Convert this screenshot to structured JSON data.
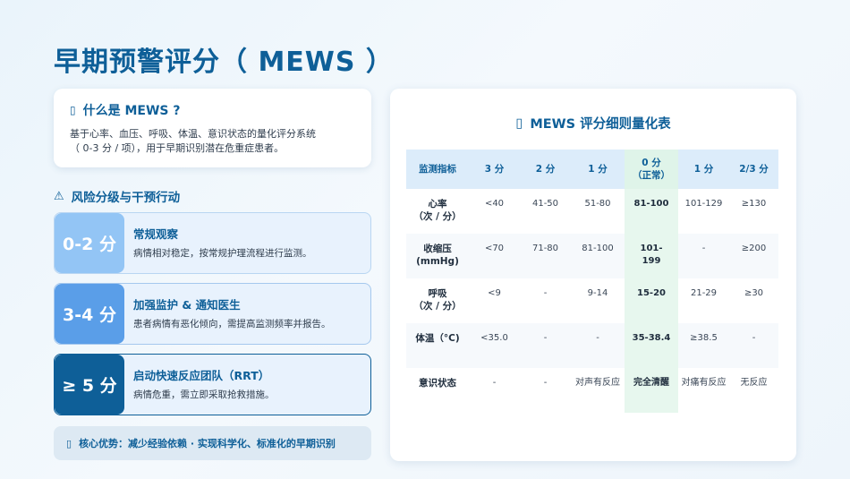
{
  "page": {
    "title": "早期预警评分（ MEWS ）"
  },
  "what": {
    "icon": "info-icon",
    "title": "什么是  MEWS ?",
    "desc_line1": "基于心率、血压、呼吸、体温、意识状态的量化评分系统",
    "desc_line2": "（  0-3 分 / 项），用于早期识别潜在危重症患者。"
  },
  "risk": {
    "icon": "warning-icon",
    "heading": "风险分级与干预行动",
    "levels": [
      {
        "score": "0-2 分",
        "title": "常规观察",
        "desc": "病情相对稳定，按常规护理流程进行监测。"
      },
      {
        "score": "3-4 分",
        "title": "加强监护  &  通知医生",
        "desc": "患者病情有恶化倾向，需提高监测频率并报告。"
      },
      {
        "score": "≥ 5 分",
        "title": "启动快速反应团队（RRT）",
        "desc": "病情危重，需立即采取抢救措施。"
      }
    ]
  },
  "advantage": {
    "icon": "star-icon",
    "text": "核心优势：减少经验依赖 · 实现科学化、标准化的早期识别"
  },
  "table": {
    "icon": "table-icon",
    "title": "MEWS  评分细则量化表",
    "headers": [
      "监测指标",
      "3 分",
      "2 分",
      "1 分",
      "0 分\n（正常）",
      "1 分",
      "2/3 分"
    ],
    "rows": [
      {
        "name": "心率\n（次 / 分）",
        "cells": [
          "<40",
          "41-50",
          "51-80",
          "81-100",
          "101-129",
          "≥130"
        ]
      },
      {
        "name": "收缩压\n(mmHg)",
        "cells": [
          "<70",
          "71-80",
          "81-100",
          "101-\n199",
          "-",
          "≥200"
        ]
      },
      {
        "name": "呼吸\n（次 / 分）",
        "cells": [
          "<9",
          "-",
          "9-14",
          "15-20",
          "21-29",
          "≥30"
        ]
      },
      {
        "name": "体温（°C)",
        "cells": [
          "<35.0",
          "-",
          "-",
          "35-38.4",
          "≥38.5",
          "-"
        ]
      },
      {
        "name": "意识状态",
        "cells": [
          "-",
          "-",
          "对声有反应",
          "完全清醒",
          "对痛有反应",
          "无反应"
        ]
      }
    ]
  },
  "colors": {
    "primary": "#0e5f98",
    "level1": "#93c5f5",
    "level2": "#5a9ee8",
    "level3": "#0e5f98",
    "normal_column": "#e7f7ee"
  }
}
